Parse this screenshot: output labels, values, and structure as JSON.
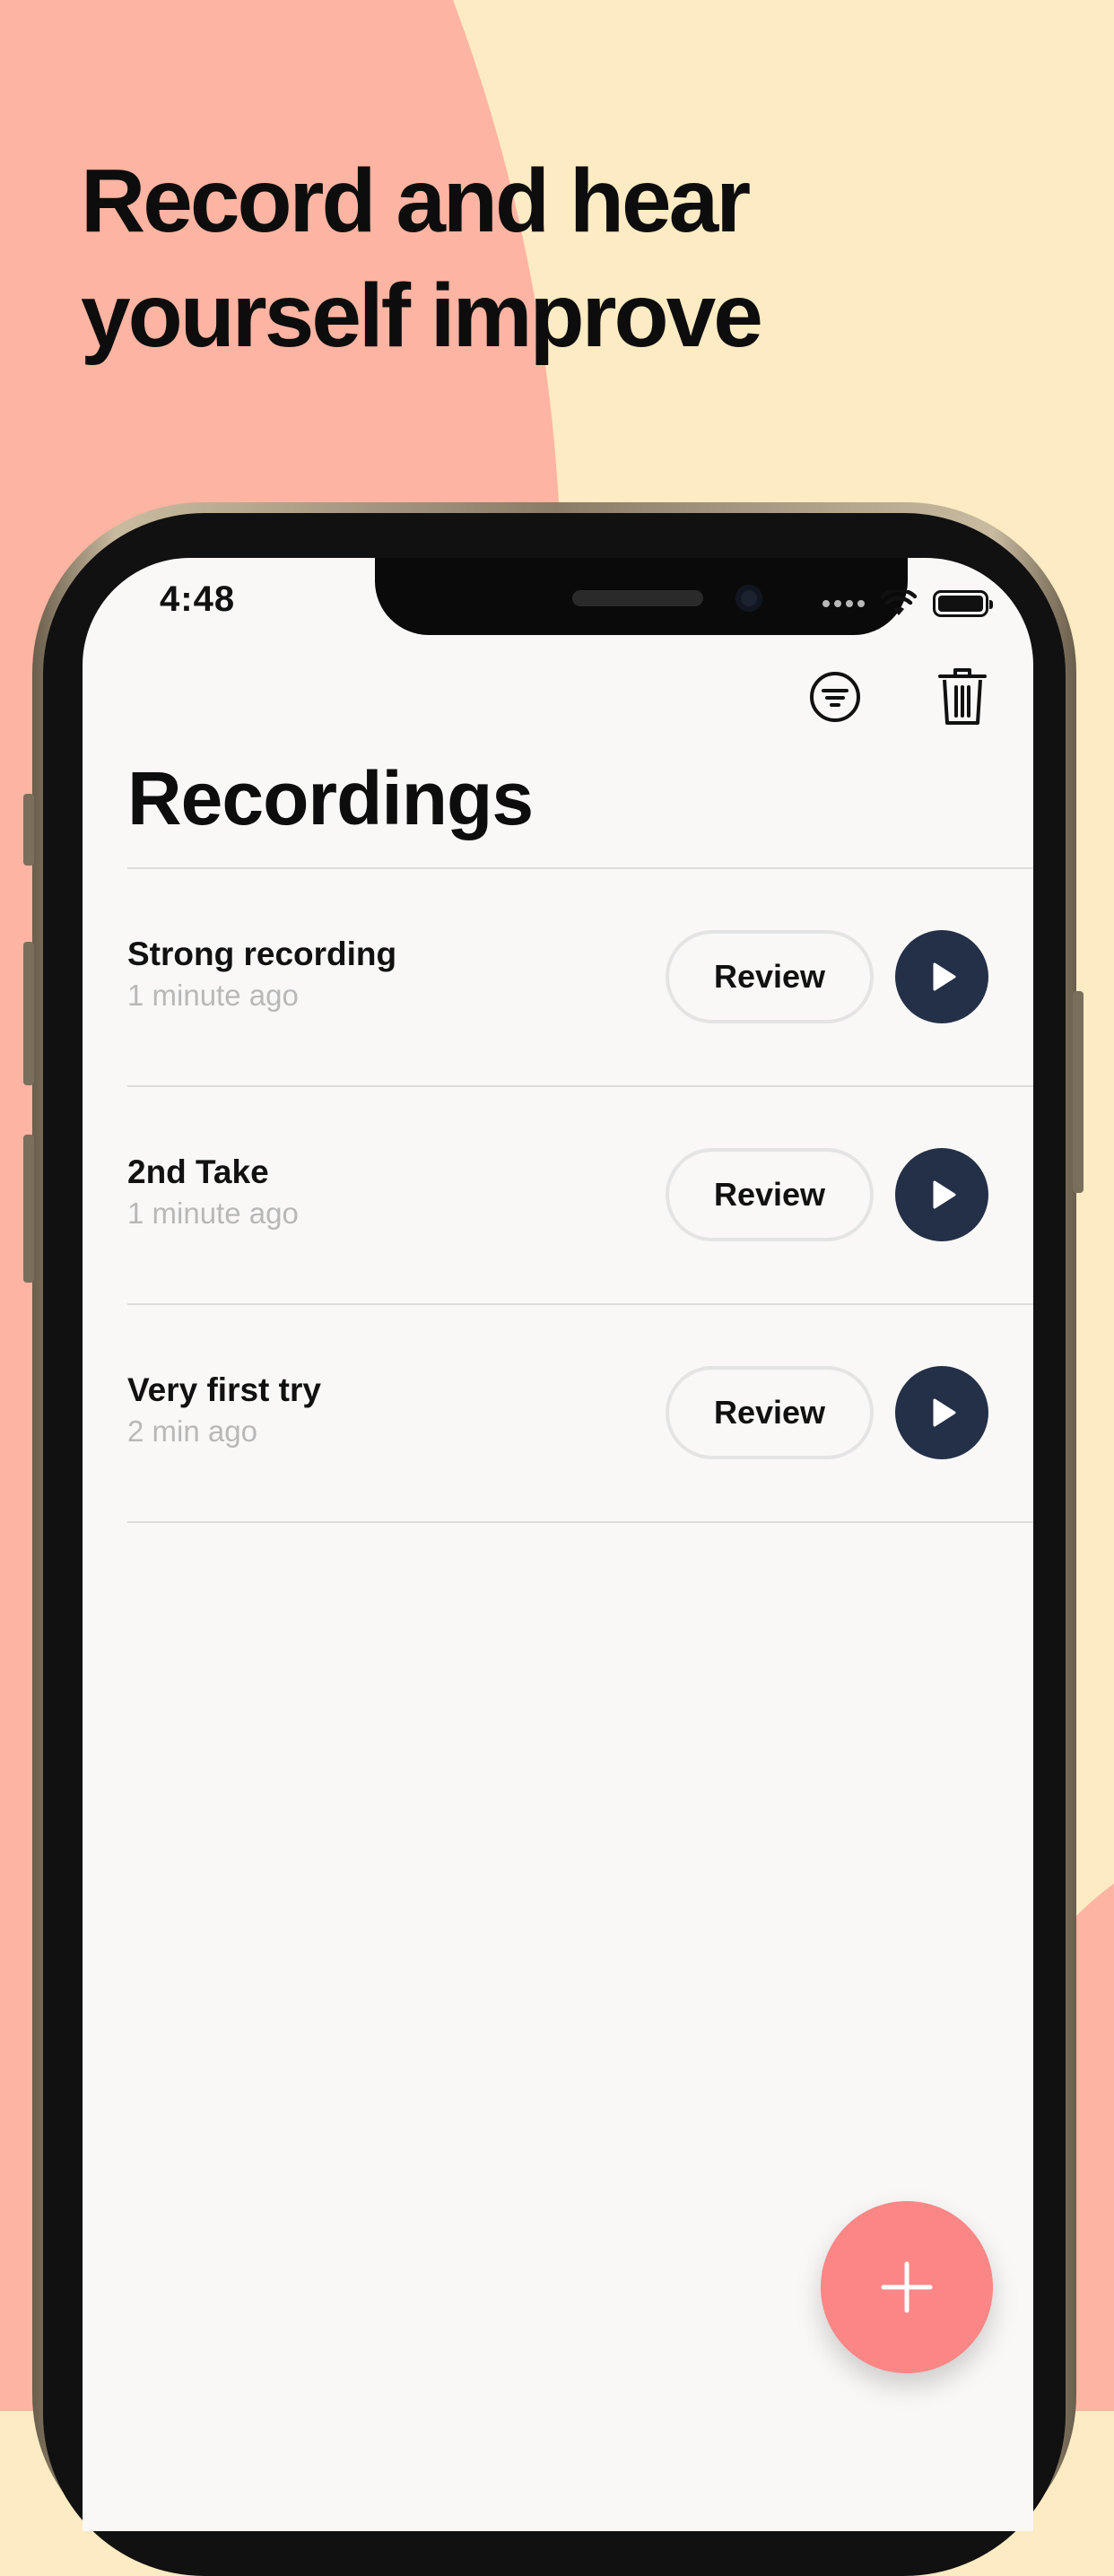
{
  "promo": {
    "headline_line1": "Record and hear",
    "headline_line2": "yourself improve"
  },
  "colors": {
    "background_peach": "#FEB4A2",
    "background_cream": "#FCEBC3",
    "screen_background": "#F9F8F7",
    "play_button": "#243047",
    "fab": "#FB8686",
    "subtitle_gray": "#B8B8B8"
  },
  "status_bar": {
    "time": "4:48",
    "icons": [
      "cellular-signal-icon",
      "wifi-icon",
      "battery-icon"
    ]
  },
  "toolbar": {
    "icons": [
      "filter-icon",
      "trash-icon"
    ]
  },
  "screen": {
    "title": "Recordings"
  },
  "recordings": [
    {
      "title": "Strong recording",
      "time_ago": "1 minute ago",
      "review_label": "Review"
    },
    {
      "title": "2nd Take",
      "time_ago": "1 minute ago",
      "review_label": "Review"
    },
    {
      "title": "Very first try",
      "time_ago": "2 min ago",
      "review_label": "Review"
    }
  ],
  "fab": {
    "icon": "plus-icon"
  }
}
